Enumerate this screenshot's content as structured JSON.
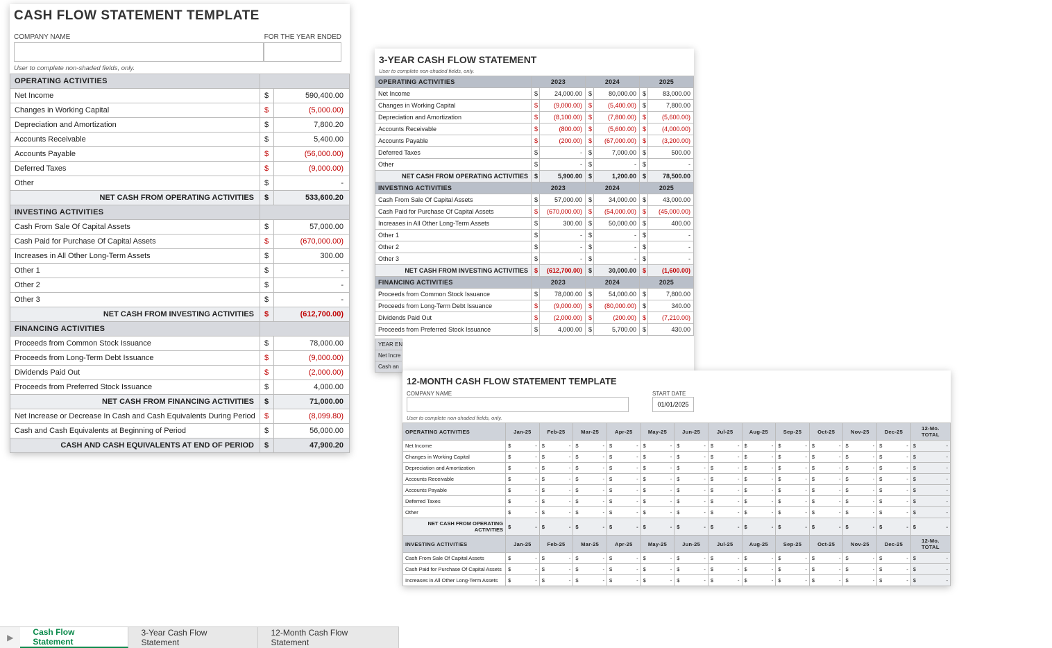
{
  "panel1": {
    "title": "CASH FLOW STATEMENT TEMPLATE",
    "company_label": "COMPANY NAME",
    "year_label": "FOR THE YEAR ENDED",
    "note": "User to complete non-shaded fields, only.",
    "sections": {
      "operating": {
        "header": "OPERATING ACTIVITIES",
        "rows": [
          {
            "label": "Net Income",
            "value": "590,400.00",
            "neg": false
          },
          {
            "label": "Changes in Working Capital",
            "value": "(5,000.00)",
            "neg": true
          },
          {
            "label": "Depreciation and Amortization",
            "value": "7,800.20",
            "neg": false
          },
          {
            "label": "Accounts Receivable",
            "value": "5,400.00",
            "neg": false
          },
          {
            "label": "Accounts Payable",
            "value": "(56,000.00)",
            "neg": true
          },
          {
            "label": "Deferred Taxes",
            "value": "(9,000.00)",
            "neg": true
          },
          {
            "label": "Other",
            "value": "-",
            "neg": false
          }
        ],
        "total_label": "NET CASH FROM OPERATING ACTIVITIES",
        "total_value": "533,600.20",
        "total_neg": false
      },
      "investing": {
        "header": "INVESTING ACTIVITIES",
        "rows": [
          {
            "label": "Cash From Sale Of Capital Assets",
            "value": "57,000.00",
            "neg": false
          },
          {
            "label": "Cash Paid for Purchase Of Capital Assets",
            "value": "(670,000.00)",
            "neg": true
          },
          {
            "label": "Increases in All Other Long-Term Assets",
            "value": "300.00",
            "neg": false
          },
          {
            "label": "Other 1",
            "value": "-",
            "neg": false
          },
          {
            "label": "Other 2",
            "value": "-",
            "neg": false
          },
          {
            "label": "Other 3",
            "value": "-",
            "neg": false
          }
        ],
        "total_label": "NET CASH FROM INVESTING ACTIVITIES",
        "total_value": "(612,700.00)",
        "total_neg": true
      },
      "financing": {
        "header": "FINANCING ACTIVITIES",
        "rows": [
          {
            "label": "Proceeds from Common Stock Issuance",
            "value": "78,000.00",
            "neg": false
          },
          {
            "label": "Proceeds from Long-Term Debt Issuance",
            "value": "(9,000.00)",
            "neg": true
          },
          {
            "label": "Dividends Paid Out",
            "value": "(2,000.00)",
            "neg": true
          },
          {
            "label": "Proceeds from Preferred Stock Issuance",
            "value": "4,000.00",
            "neg": false
          }
        ],
        "total_label": "NET CASH FROM FINANCING ACTIVITIES",
        "total_value": "71,000.00",
        "total_neg": false
      },
      "summary": [
        {
          "label": "Net Increase or Decrease In Cash and Cash Equivalents During Period",
          "value": "(8,099.80)",
          "neg": true,
          "bold": false
        },
        {
          "label": "Cash and Cash Equivalents at Beginning of Period",
          "value": "56,000.00",
          "neg": false,
          "bold": false
        },
        {
          "label": "CASH AND CASH EQUIVALENTS AT END OF PERIOD",
          "value": "47,900.20",
          "neg": false,
          "bold": true
        }
      ]
    }
  },
  "panel2": {
    "title": "3-YEAR CASH FLOW STATEMENT",
    "note": "User to complete non-shaded fields, only.",
    "years": [
      "2023",
      "2024",
      "2025"
    ],
    "sections": {
      "operating": {
        "header": "OPERATING ACTIVITIES",
        "rows": [
          {
            "label": "Net Income",
            "v": [
              "24,000.00",
              "80,000.00",
              "83,000.00"
            ],
            "neg": [
              false,
              false,
              false
            ]
          },
          {
            "label": "Changes in Working Capital",
            "v": [
              "(9,000.00)",
              "(5,400.00)",
              "7,800.00"
            ],
            "neg": [
              true,
              true,
              false
            ]
          },
          {
            "label": "Depreciation and Amortization",
            "v": [
              "(8,100.00)",
              "(7,800.00)",
              "(5,600.00)"
            ],
            "neg": [
              true,
              true,
              true
            ]
          },
          {
            "label": "Accounts Receivable",
            "v": [
              "(800.00)",
              "(5,600.00)",
              "(4,000.00)"
            ],
            "neg": [
              true,
              true,
              true
            ]
          },
          {
            "label": "Accounts Payable",
            "v": [
              "(200.00)",
              "(67,000.00)",
              "(3,200.00)"
            ],
            "neg": [
              true,
              true,
              true
            ]
          },
          {
            "label": "Deferred Taxes",
            "v": [
              "-",
              "7,000.00",
              "500.00"
            ],
            "neg": [
              false,
              false,
              false
            ]
          },
          {
            "label": "Other",
            "v": [
              "-",
              "-",
              "-"
            ],
            "neg": [
              false,
              false,
              false
            ]
          }
        ],
        "total_label": "NET CASH FROM OPERATING ACTIVITIES",
        "total": [
          "5,900.00",
          "1,200.00",
          "78,500.00"
        ],
        "total_neg": [
          false,
          false,
          false
        ]
      },
      "investing": {
        "header": "INVESTING ACTIVITIES",
        "rows": [
          {
            "label": "Cash From Sale Of Capital Assets",
            "v": [
              "57,000.00",
              "34,000.00",
              "43,000.00"
            ],
            "neg": [
              false,
              false,
              false
            ]
          },
          {
            "label": "Cash Paid for Purchase Of Capital Assets",
            "v": [
              "(670,000.00)",
              "(54,000.00)",
              "(45,000.00)"
            ],
            "neg": [
              true,
              true,
              true
            ]
          },
          {
            "label": "Increases in All Other Long-Term Assets",
            "v": [
              "300.00",
              "50,000.00",
              "400.00"
            ],
            "neg": [
              false,
              false,
              false
            ]
          },
          {
            "label": "Other 1",
            "v": [
              "-",
              "-",
              "-"
            ],
            "neg": [
              false,
              false,
              false
            ]
          },
          {
            "label": "Other 2",
            "v": [
              "-",
              "-",
              "-"
            ],
            "neg": [
              false,
              false,
              false
            ]
          },
          {
            "label": "Other 3",
            "v": [
              "-",
              "-",
              "-"
            ],
            "neg": [
              false,
              false,
              false
            ]
          }
        ],
        "total_label": "NET CASH FROM INVESTING ACTIVITIES",
        "total": [
          "(612,700.00)",
          "30,000.00",
          "(1,600.00)"
        ],
        "total_neg": [
          true,
          false,
          true
        ]
      },
      "financing": {
        "header": "FINANCING ACTIVITIES",
        "rows": [
          {
            "label": "Proceeds from Common Stock Issuance",
            "v": [
              "78,000.00",
              "54,000.00",
              "7,800.00"
            ],
            "neg": [
              false,
              false,
              false
            ]
          },
          {
            "label": "Proceeds from Long-Term Debt Issuance",
            "v": [
              "(9,000.00)",
              "(80,000.00)",
              "340.00"
            ],
            "neg": [
              true,
              true,
              false
            ]
          },
          {
            "label": "Dividends Paid Out",
            "v": [
              "(2,000.00)",
              "(200.00)",
              "(7,210.00)"
            ],
            "neg": [
              true,
              true,
              true
            ]
          },
          {
            "label": "Proceeds from Preferred Stock Issuance",
            "v": [
              "4,000.00",
              "5,700.00",
              "430.00"
            ],
            "neg": [
              false,
              false,
              false
            ]
          }
        ]
      }
    },
    "footer_rows": [
      {
        "label": "YEAR EN"
      },
      {
        "label": "Net Incre"
      },
      {
        "label": "Cash an"
      }
    ]
  },
  "panel3": {
    "title": "12-MONTH CASH FLOW STATEMENT TEMPLATE",
    "company_label": "COMPANY NAME",
    "start_label": "START DATE",
    "start_value": "01/01/2025",
    "note": "User to complete non-shaded fields, only.",
    "months": [
      "Jan-25",
      "Feb-25",
      "Mar-25",
      "Apr-25",
      "May-25",
      "Jun-25",
      "Jul-25",
      "Aug-25",
      "Sep-25",
      "Oct-25",
      "Nov-25",
      "Dec-25"
    ],
    "total_label": "12-Mo. TOTAL",
    "sections": {
      "operating": {
        "header": "OPERATING ACTIVITIES",
        "rows": [
          "Net Income",
          "Changes in Working Capital",
          "Depreciation and Amortization",
          "Accounts Receivable",
          "Accounts Payable",
          "Deferred Taxes",
          "Other"
        ],
        "total_label": "NET CASH FROM OPERATING ACTIVITIES"
      },
      "investing": {
        "header": "INVESTING ACTIVITIES",
        "rows": [
          "Cash From Sale Of Capital Assets",
          "Cash Paid for Purchase Of Capital Assets",
          "Increases in All Other Long-Term Assets"
        ]
      }
    }
  },
  "tabs": {
    "items": [
      {
        "label": "Cash Flow Statement",
        "active": true
      },
      {
        "label": "3-Year Cash Flow Statement",
        "active": false
      },
      {
        "label": "12-Month Cash Flow Statement",
        "active": false
      }
    ]
  }
}
